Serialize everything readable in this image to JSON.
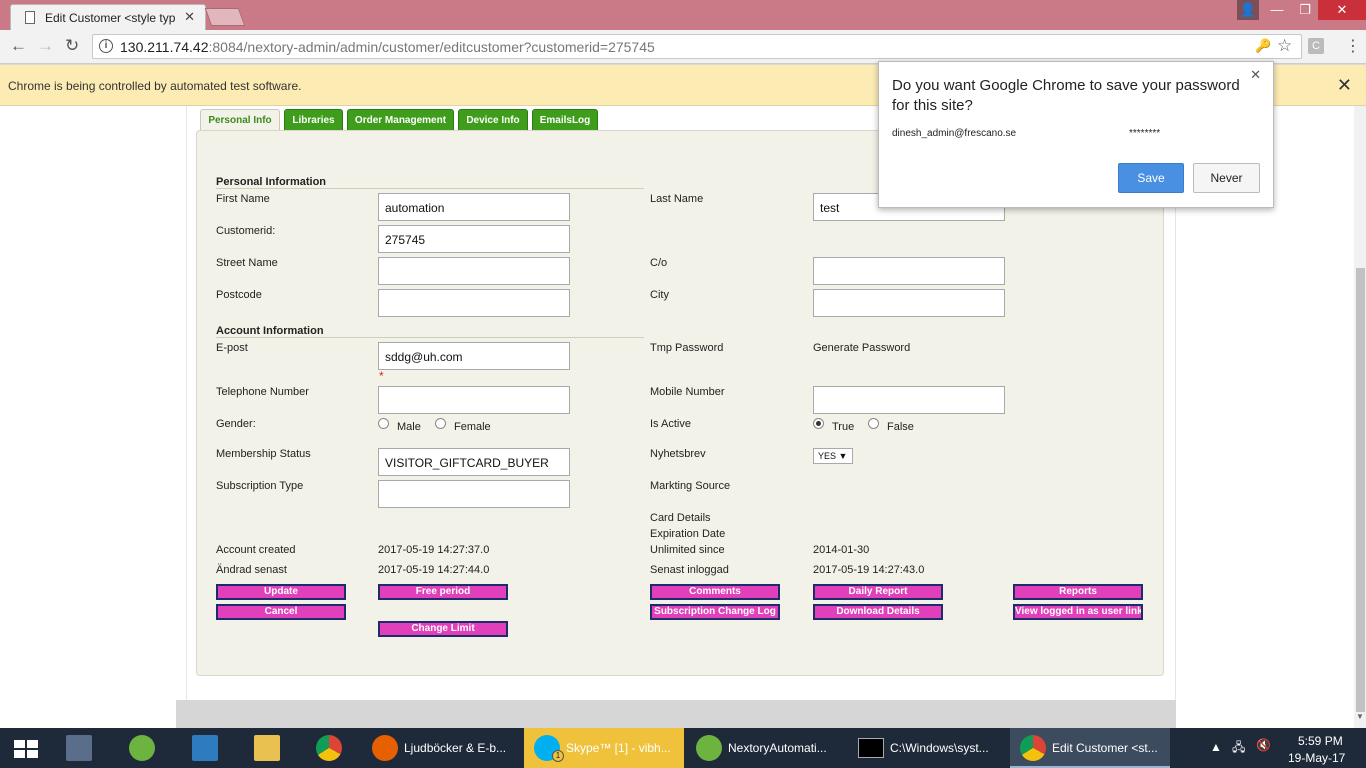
{
  "browser": {
    "tab_title": "Edit Customer <style typ",
    "url_host": "130.211.74.42",
    "url_rest": ":8084/nextory-admin/admin/customer/editcustomer?customerid=275745",
    "infobar_message": "Chrome is being controlled by automated test software.",
    "icons": {
      "back": "back-arrow-icon",
      "forward": "forward-arrow-icon",
      "reload": "reload-icon",
      "info": "info-icon",
      "key": "key-icon",
      "star": "bookmark-star-icon",
      "menu": "menu-icon"
    }
  },
  "password_bubble": {
    "question": "Do you want Google Chrome to save your password for this site?",
    "username": "dinesh_admin@frescano.se",
    "password": "********",
    "save_label": "Save",
    "never_label": "Never"
  },
  "tabs": [
    {
      "label": "Personal Info",
      "active": true
    },
    {
      "label": "Libraries",
      "active": false
    },
    {
      "label": "Order Management",
      "active": false
    },
    {
      "label": "Device Info",
      "active": false
    },
    {
      "label": "EmailsLog",
      "active": false
    }
  ],
  "personal": {
    "section_title": "Personal Information",
    "first_name_label": "First Name",
    "first_name_value": "automation",
    "last_name_label": "Last Name",
    "last_name_value": "test",
    "customerid_label": "Customerid:",
    "customerid_value": "275745",
    "street_label": "Street Name",
    "street_value": "",
    "co_label": "C/o",
    "co_value": "",
    "postcode_label": "Postcode",
    "postcode_value": "",
    "city_label": "City",
    "city_value": ""
  },
  "account": {
    "section_title": "Account Information",
    "epost_label": "E-post",
    "epost_value": "sddg@uh.com",
    "required_mark": "*",
    "tmp_password_label": "Tmp Password",
    "generate_password": "Generate Password",
    "telephone_label": "Telephone Number",
    "telephone_value": "",
    "mobile_label": "Mobile Number",
    "mobile_value": "",
    "gender_label": "Gender:",
    "gender_male": "Male",
    "gender_female": "Female",
    "is_active_label": "Is Active",
    "is_active_true": "True",
    "is_active_false": "False",
    "membership_label": "Membership Status",
    "membership_value": "VISITOR_GIFTCARD_BUYER",
    "nyhetsbrev_label": "Nyhetsbrev",
    "nyhetsbrev_value": "YES",
    "subscription_type_label": "Subscription Type",
    "subscription_type_value": "",
    "markting_source_label": "Markting Source",
    "card_details_label": "Card Details",
    "expiration_date_label": "Expiration Date",
    "account_created_label": "Account created",
    "account_created_value": "2017-05-19 14:27:37.0",
    "unlimited_since_label": "Unlimited since",
    "unlimited_since_value": "2014-01-30",
    "andrad_label": "Ändrad senast",
    "andrad_value": "2017-05-19 14:27:44.0",
    "senast_label": "Senast inloggad",
    "senast_value": "2017-05-19 14:27:43.0"
  },
  "buttons": {
    "update": "Update",
    "free_period": "Free period",
    "comments": "Comments",
    "daily_report": "Daily Report",
    "reports": "Reports",
    "cancel": "Cancel",
    "subscription_change_log": "Subscription Change Log",
    "download_details": "Download Details",
    "view_logged_in": "View logged in as user link",
    "change_limit": "Change Limit"
  },
  "taskbar": {
    "tasks": [
      {
        "label": "Ljudböcker & E-b..."
      },
      {
        "label": "Skype™ [1] - vibh..."
      },
      {
        "label": "NextoryAutomati..."
      },
      {
        "label": "C:\\Windows\\syst..."
      },
      {
        "label": "Edit Customer <st..."
      }
    ],
    "skype_badge": "1",
    "time": "5:59 PM",
    "date": "19-May-17"
  },
  "colors": {
    "titlebar": "#c97a86",
    "tab_green": "#3f9d1c",
    "button_pink": "#e23fba",
    "button_border": "#1f2c6b",
    "panel_bg": "#f3f2e8",
    "infobar": "#fcecb4",
    "save_blue": "#4a90e2"
  }
}
